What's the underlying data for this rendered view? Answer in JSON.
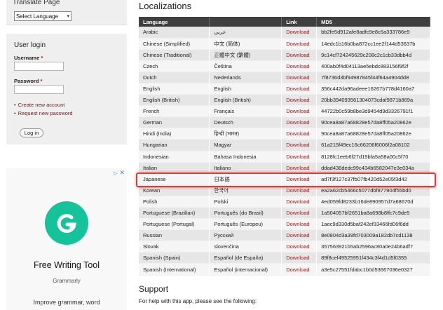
{
  "sidebar": {
    "translate": {
      "title": "Translate Page",
      "select_value": "Select Language"
    },
    "login": {
      "title": "User login",
      "username_label": "Username",
      "password_label": "Password",
      "required_mark": "*",
      "links": [
        "Create new account",
        "Request new password"
      ],
      "button_label": "Log in"
    },
    "ad": {
      "title": "Free Writing Tool",
      "brand": "Grammarly",
      "description": "Improve grammar, word",
      "logo_color": "#15c39a"
    }
  },
  "main": {
    "heading": "Localizations",
    "columns": [
      "Language",
      "",
      "Link",
      "MD5"
    ],
    "rows": [
      [
        "Arabic",
        "عربي",
        "Download",
        "bb2fe5d912afe8adfc9e8c5a333786e9"
      ],
      [
        "Chinese (Simplified)",
        "中文 (简体)",
        "Download",
        "14edc1b16b0ba872cc1ee2f144d53637b"
      ],
      [
        "Chinese (Traditional)",
        "正體中文 (繁體)",
        "Download",
        "9c14cf724245629c208c2c1cb33dbb4d"
      ],
      [
        "Czech",
        "Čeština",
        "Download",
        "400ab0f4d04113ae5ebdc883156f9f2f"
      ],
      [
        "Dutch",
        "Nederlands",
        "Download",
        "7f8736d3bf94987845f44f64a4904dd8"
      ],
      [
        "English",
        "English",
        "Download",
        "356c442da96adeee16267b778d4160a7"
      ],
      [
        "English (British)",
        "English (British)",
        "Download",
        "20bb394093561304073cdaf9871b869a"
      ],
      [
        "French",
        "Français",
        "Download",
        "44722b0c59b8be3d9454d9d3326791f1"
      ],
      [
        "German",
        "Deutsch",
        "Download",
        "90cea8a87a68828e57da8ff05a20862e"
      ],
      [
        "Hindi (India)",
        "हिन्दी (भारत)",
        "Download",
        "90cea8a87a68828e57da8ff05a20862e"
      ],
      [
        "Hungarian",
        "Magyar",
        "Download",
        "61a215f49ec16c66206f6006f2a08102"
      ],
      [
        "Indonesian",
        "Bahasa Indonesia",
        "Download",
        "8128fc1eeb6f27d19bfa5a58a00c5f70"
      ],
      [
        "Italian",
        "Italiano",
        "Download",
        "ddad438dedc99c434b6582047e3e034a"
      ],
      [
        "Japanese",
        "日本語",
        "Download",
        "ad7f3f127c37fb07fb420d52e05f3d42"
      ],
      [
        "Korean",
        "한국어",
        "Download",
        "ea2a62cb5466c5077dbf877904f55bd0"
      ],
      [
        "Polish",
        "Polski",
        "Download",
        "4ed059fd8233b16de890957d7a68670d"
      ],
      [
        "Portuguese (Brazilian)",
        "Português (do Brasil)",
        "Download",
        "1a504057bf2651ba8a698b8ffc7c9de5"
      ],
      [
        "Portuguese (Portugal)",
        "Português (Europeu)",
        "Download",
        "1aec9d330d5baf242ef33466fd06f6dd"
      ],
      [
        "Russian",
        "Русский",
        "Download",
        "8e0804d3a39fd703009a182db7cd1138"
      ],
      [
        "Slovak",
        "slovenčina",
        "Download",
        "357563921b5ab2596ac80a0e24b6adf7"
      ],
      [
        "Spanish (Spain)",
        "Español (de España)",
        "Download",
        "89f8cef49525951f434c3f4d1d5f0355"
      ],
      [
        "Spanish (International)",
        "Español (internacional)",
        "Download",
        "a3e5c27551fdabc1b0d53667036e0327"
      ]
    ],
    "support_title": "Support",
    "support_text": "For help with this app, please see the following:"
  }
}
